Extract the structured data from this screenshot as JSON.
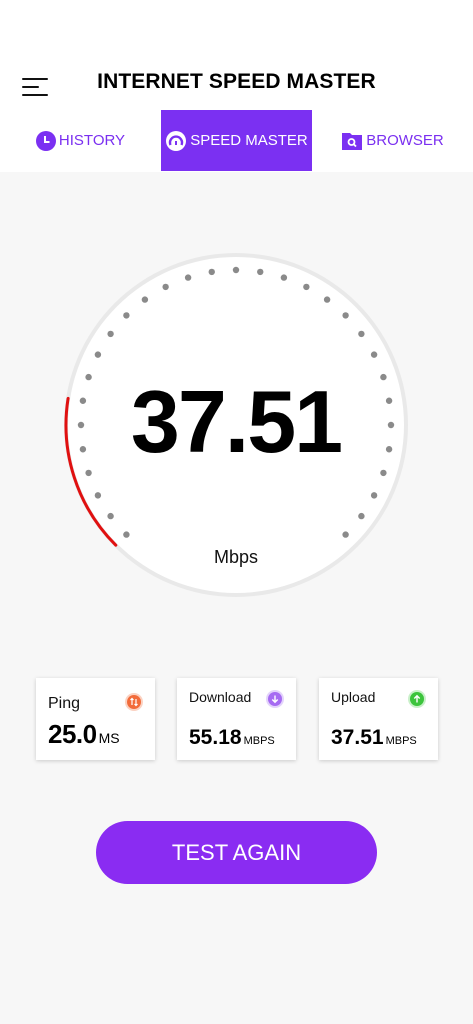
{
  "header": {
    "title": "INTERNET SPEED MASTER"
  },
  "tabs": [
    {
      "label": "HISTORY",
      "icon": "clock-icon",
      "active": false
    },
    {
      "label": "SPEED MASTER",
      "icon": "speedometer-icon",
      "active": true
    },
    {
      "label": "BROWSER",
      "icon": "folder-search-icon",
      "active": false
    }
  ],
  "gauge": {
    "value": "37.51",
    "unit": "Mbps",
    "progress_fraction": 0.2,
    "progress_color": "#e01010"
  },
  "stats": {
    "ping": {
      "label": "Ping",
      "value": "25.0",
      "unit": "MS",
      "icon": "ping-icon",
      "icon_color": "#f26b3a"
    },
    "download": {
      "label": "Download",
      "value": "55.18",
      "unit": "MBPS",
      "icon": "download-arrow-icon",
      "icon_color": "#a66bf2"
    },
    "upload": {
      "label": "Upload",
      "value": "37.51",
      "unit": "MBPS",
      "icon": "upload-arrow-icon",
      "icon_color": "#3cc43c"
    }
  },
  "actions": {
    "test_again_label": "TEST AGAIN"
  },
  "colors": {
    "accent": "#7b30f2",
    "button": "#8a2cf2"
  }
}
